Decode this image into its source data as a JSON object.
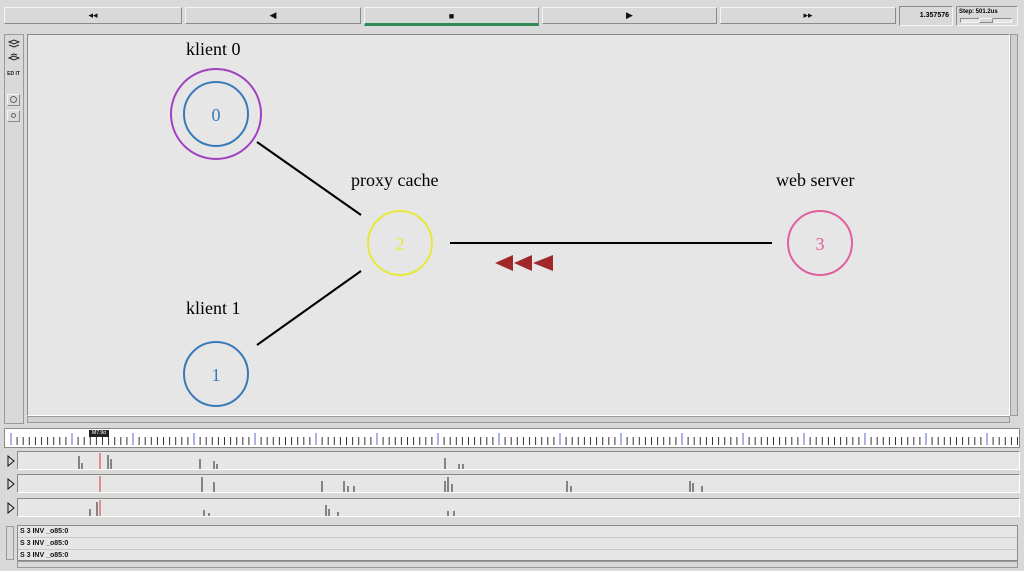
{
  "toolbar": {
    "rewind_icon": "◂◂",
    "back_icon": "◀",
    "stop_icon": "■",
    "play_icon": "▶",
    "fastforward_icon": "▸▸",
    "time": "1.357576",
    "step_label": "Step: 501.2us"
  },
  "side_tools": [
    "pointer-tool-icon",
    "zoom-tool-icon",
    "edit-tool-icon",
    "zoom-in-icon",
    "zoom-out-icon"
  ],
  "edit_label": "ED IT",
  "nodes": [
    {
      "id": "0",
      "label": "klient 0",
      "color": "#3a7ab8",
      "ring": "#a040c0"
    },
    {
      "id": "1",
      "label": "klient 1",
      "color": "#3a7ab8"
    },
    {
      "id": "2",
      "label": "proxy cache",
      "color": "#e8e838"
    },
    {
      "id": "3",
      "label": "web server",
      "color": "#e060a0"
    }
  ],
  "packet_color": "#a02828",
  "timeline_marker": "M7.9d",
  "log": [
    "S 3 INV _o85:0",
    "S 3 INV _o85:0",
    "S 3 INV _o85:0"
  ]
}
